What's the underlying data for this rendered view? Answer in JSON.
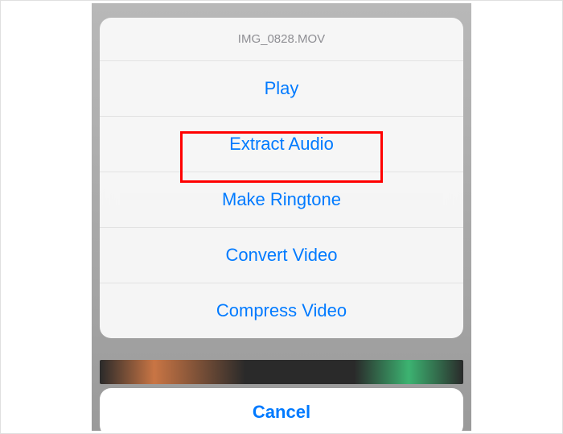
{
  "sheet": {
    "title": "IMG_0828.MOV",
    "options": [
      {
        "label": "Play"
      },
      {
        "label": "Extract Audio"
      },
      {
        "label": "Make Ringtone"
      },
      {
        "label": "Convert Video"
      },
      {
        "label": "Compress Video"
      }
    ],
    "cancel_label": "Cancel"
  }
}
